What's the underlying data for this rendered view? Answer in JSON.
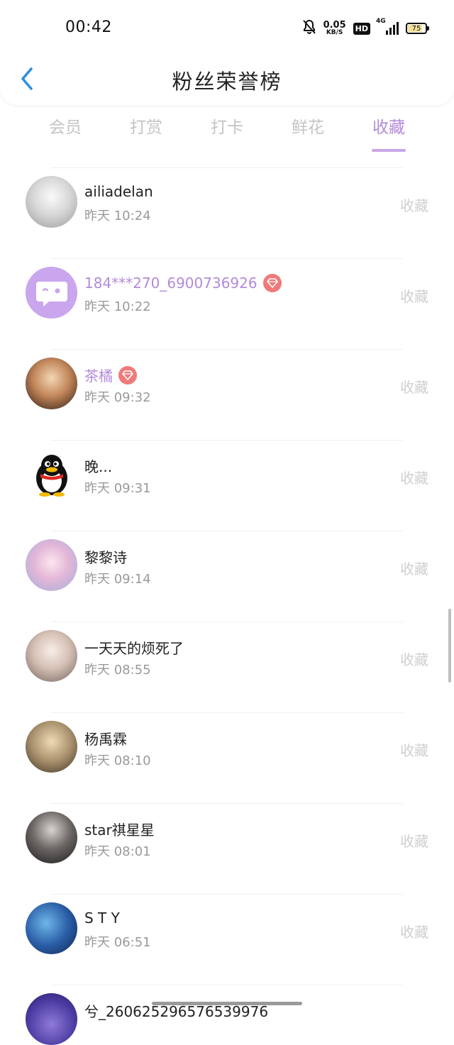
{
  "status": {
    "time": "00:42",
    "net_speed_value": "0.05",
    "net_speed_unit": "KB/S",
    "hd": "HD",
    "network": "4G",
    "battery": "75"
  },
  "header": {
    "title": "粉丝荣誉榜"
  },
  "tabs": [
    {
      "label": "会员"
    },
    {
      "label": "打赏"
    },
    {
      "label": "打卡"
    },
    {
      "label": "鲜花"
    },
    {
      "label": "收藏"
    }
  ],
  "active_tab": "收藏",
  "fans": [
    {
      "name": "ailiadelan",
      "time": "昨天 10:24",
      "action": "收藏"
    },
    {
      "name": "184***270_6900736926",
      "time": "昨天 10:22",
      "action": "收藏"
    },
    {
      "name": "茶橘",
      "time": "昨天 09:32",
      "action": "收藏"
    },
    {
      "name": "晚...",
      "time": "昨天 09:31",
      "action": "收藏"
    },
    {
      "name": "黎黎诗",
      "time": "昨天 09:14",
      "action": "收藏"
    },
    {
      "name": "一天天的烦死了",
      "time": "昨天 08:55",
      "action": "收藏"
    },
    {
      "name": "杨禹霖",
      "time": "昨天 08:10",
      "action": "收藏"
    },
    {
      "name": "star祺星星",
      "time": "昨天 08:01",
      "action": "收藏"
    },
    {
      "name": "S T Y",
      "time": "昨天 06:51",
      "action": "收藏"
    },
    {
      "name": "兮_2606252965765399​76",
      "time": "",
      "action": ""
    }
  ],
  "colors": {
    "accent": "#b38ad9",
    "gem": "#f07a7a",
    "inactive_tab": "#c4c4c4"
  }
}
